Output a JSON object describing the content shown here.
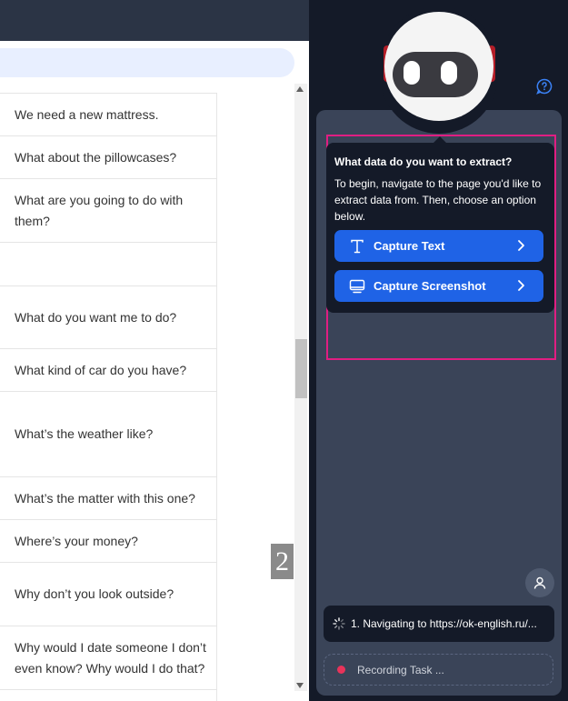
{
  "list": {
    "rows": [
      {
        "text": "We need a new mattress.",
        "h": 47
      },
      {
        "text": "What about the pillowcases?",
        "h": 47
      },
      {
        "text": "What are you going to do with them?",
        "h": 70
      },
      {
        "text": "",
        "h": 48
      },
      {
        "text": "What do you want me to do?",
        "h": 69
      },
      {
        "text": "What kind of car do you have?",
        "h": 47
      },
      {
        "text": "What’s the weather like?",
        "h": 94
      },
      {
        "text": "What’s the matter with this one?",
        "h": 47
      },
      {
        "text": "Where’s your money?",
        "h": 47
      },
      {
        "text": "Why don’t you look outside?",
        "h": 70
      },
      {
        "text": "Why would I date someone I don’t even know? Why would I do that?",
        "h": 70
      }
    ]
  },
  "page_badge": "2",
  "extension": {
    "popup_title": "What data do you want to extract?",
    "popup_description": "To begin, navigate to the page you'd like to extract data from. Then, choose an option below.",
    "capture_text_label": "Capture Text",
    "capture_screenshot_label": "Capture Screenshot",
    "status_text": "1. Navigating to https://ok-english.ru/...",
    "recording_label": "Recording Task ...",
    "accent_color": "#1f63e6",
    "highlight_color": "#e01e82"
  }
}
